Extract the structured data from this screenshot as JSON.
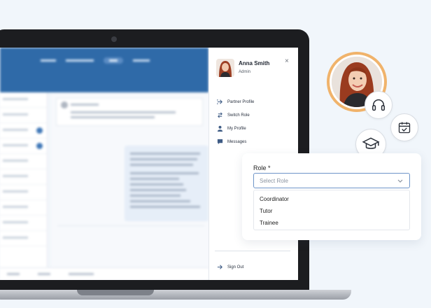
{
  "panel": {
    "user_name": "Anna Smith",
    "user_role": "Admin",
    "close_glyph": "×",
    "menu": [
      {
        "label": "Partner Profile",
        "icon": "arrow-right-icon"
      },
      {
        "label": "Switch Role",
        "icon": "switch-icon"
      },
      {
        "label": "My Profile",
        "icon": "user-icon"
      },
      {
        "label": "Messages",
        "icon": "message-icon"
      }
    ],
    "sign_out": {
      "label": "Sign Out",
      "icon": "sign-out-icon"
    }
  },
  "role_selector": {
    "label": "Role *",
    "placeholder": "Select Role",
    "options": [
      "Coordinator",
      "Tutor",
      "Trainee"
    ]
  },
  "icons": [
    "headset-icon",
    "calendar-check-icon",
    "graduation-cap-icon"
  ],
  "colors": {
    "header_blue": "#2f6aa8",
    "avatar_ring": "#f0b36b",
    "select_border": "#6f95c8"
  }
}
